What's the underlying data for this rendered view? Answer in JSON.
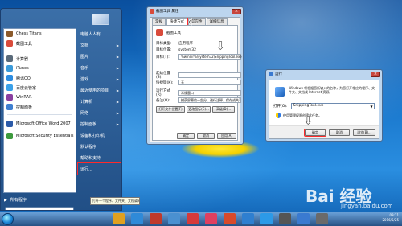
{
  "start_menu": {
    "pinned": [
      {
        "label": "Chess Titans",
        "icon": "chess-icon",
        "color": "#8b5a2b"
      },
      {
        "label": "截图工具",
        "icon": "scissors-icon",
        "color": "#d94b3b"
      },
      {
        "label": "计算器",
        "icon": "calculator-icon",
        "color": "#5a6a7a"
      },
      {
        "label": "iTunes",
        "icon": "itunes-icon",
        "color": "#3a9ad9"
      },
      {
        "label": "腾讯QQ",
        "icon": "qq-icon",
        "color": "#2d8ce0"
      },
      {
        "label": "百度云管家",
        "icon": "cloud-icon",
        "color": "#3aa0e8"
      },
      {
        "label": "WinRAR",
        "icon": "winrar-icon",
        "color": "#8a3fa0"
      },
      {
        "label": "控制面板",
        "icon": "control-panel-icon",
        "color": "#3f7fd0"
      },
      {
        "label": "Microsoft Office Word 2007",
        "icon": "word-icon",
        "color": "#2b5aa8"
      },
      {
        "label": "Microsoft Security Essentials",
        "icon": "shield-icon",
        "color": "#3d9a3d"
      }
    ],
    "all_programs": "所有程序",
    "right_items": [
      {
        "label": "电脑人人有",
        "has_arrow": false
      },
      {
        "label": "文档",
        "has_arrow": true
      },
      {
        "label": "图片",
        "has_arrow": true
      },
      {
        "label": "音乐",
        "has_arrow": true
      },
      {
        "label": "游戏",
        "has_arrow": true
      },
      {
        "label": "最近使用的项目",
        "has_arrow": true
      },
      {
        "label": "计算机",
        "has_arrow": true
      },
      {
        "label": "网络",
        "has_arrow": true
      },
      {
        "label": "控制面板",
        "has_arrow": true
      },
      {
        "label": "设备和打印机",
        "has_arrow": false
      },
      {
        "label": "默认程序",
        "has_arrow": false
      },
      {
        "label": "帮助和支持",
        "has_arrow": false
      },
      {
        "label": "运行...",
        "has_arrow": false
      }
    ],
    "tooltip": "打开一个程序、文件夹、文档或网站。"
  },
  "properties": {
    "title": "截图工具 属性",
    "tabs": [
      "常规",
      "快捷方式",
      "兼容性",
      "详细信息"
    ],
    "name": "截图工具",
    "fields": [
      {
        "label": "目标类型:",
        "value": "应用程序"
      },
      {
        "label": "目标位置:",
        "value": "system32"
      },
      {
        "label": "目标(T):",
        "value": "%windir%\\system32\\SnippingTool.exe"
      },
      {
        "label": "起始位置(S):",
        "value": ""
      },
      {
        "label": "快捷键(K):",
        "value": "无"
      },
      {
        "label": "运行方式(R):",
        "value": "常规窗口"
      },
      {
        "label": "备注(O):",
        "value": "捕获屏幕的一部分，进行注释、保存或共享。"
      }
    ],
    "buttons": [
      "打开文件位置(F)",
      "更改图标(C)...",
      "高级(D)..."
    ],
    "footer_buttons": [
      "确定",
      "取消",
      "应用(A)"
    ]
  },
  "run": {
    "title": "运行",
    "description": "Windows 将根据您所输入的名称，为您打开相应的程序、文件夹、文档或 Internet 资源。",
    "open_label": "打开(O):",
    "input_value": "SnippingTool.exe",
    "admin_note": "使用管理权限创建此任务。",
    "buttons": [
      "确定",
      "取消",
      "浏览(B)..."
    ]
  },
  "watermark": {
    "text": "Bai 经验",
    "sub": "jingyan.baidu.com"
  },
  "taskbar": {
    "apps": [
      {
        "icon": "explorer-icon",
        "color": "#e0a020"
      },
      {
        "icon": "media-player-icon",
        "color": "#2f8ad8"
      },
      {
        "icon": "browser-icon",
        "color": "#c0392b"
      },
      {
        "icon": "window-icon",
        "color": "#4a90d0"
      },
      {
        "icon": "music-icon",
        "color": "#d63a3a"
      },
      {
        "icon": "photo-icon",
        "color": "#e04060"
      },
      {
        "icon": "app-icon",
        "color": "#d84a2a"
      },
      {
        "icon": "snipping-icon",
        "color": "#2f7fd0"
      },
      {
        "icon": "qq-icon",
        "color": "#2c9ae8"
      },
      {
        "icon": "camera-icon",
        "color": "#555"
      },
      {
        "icon": "document-icon",
        "color": "#3a7ad0"
      },
      {
        "icon": "tools-icon",
        "color": "#6a6a6a"
      }
    ],
    "clock_time": "09:11",
    "clock_date": "2016/5/25"
  }
}
